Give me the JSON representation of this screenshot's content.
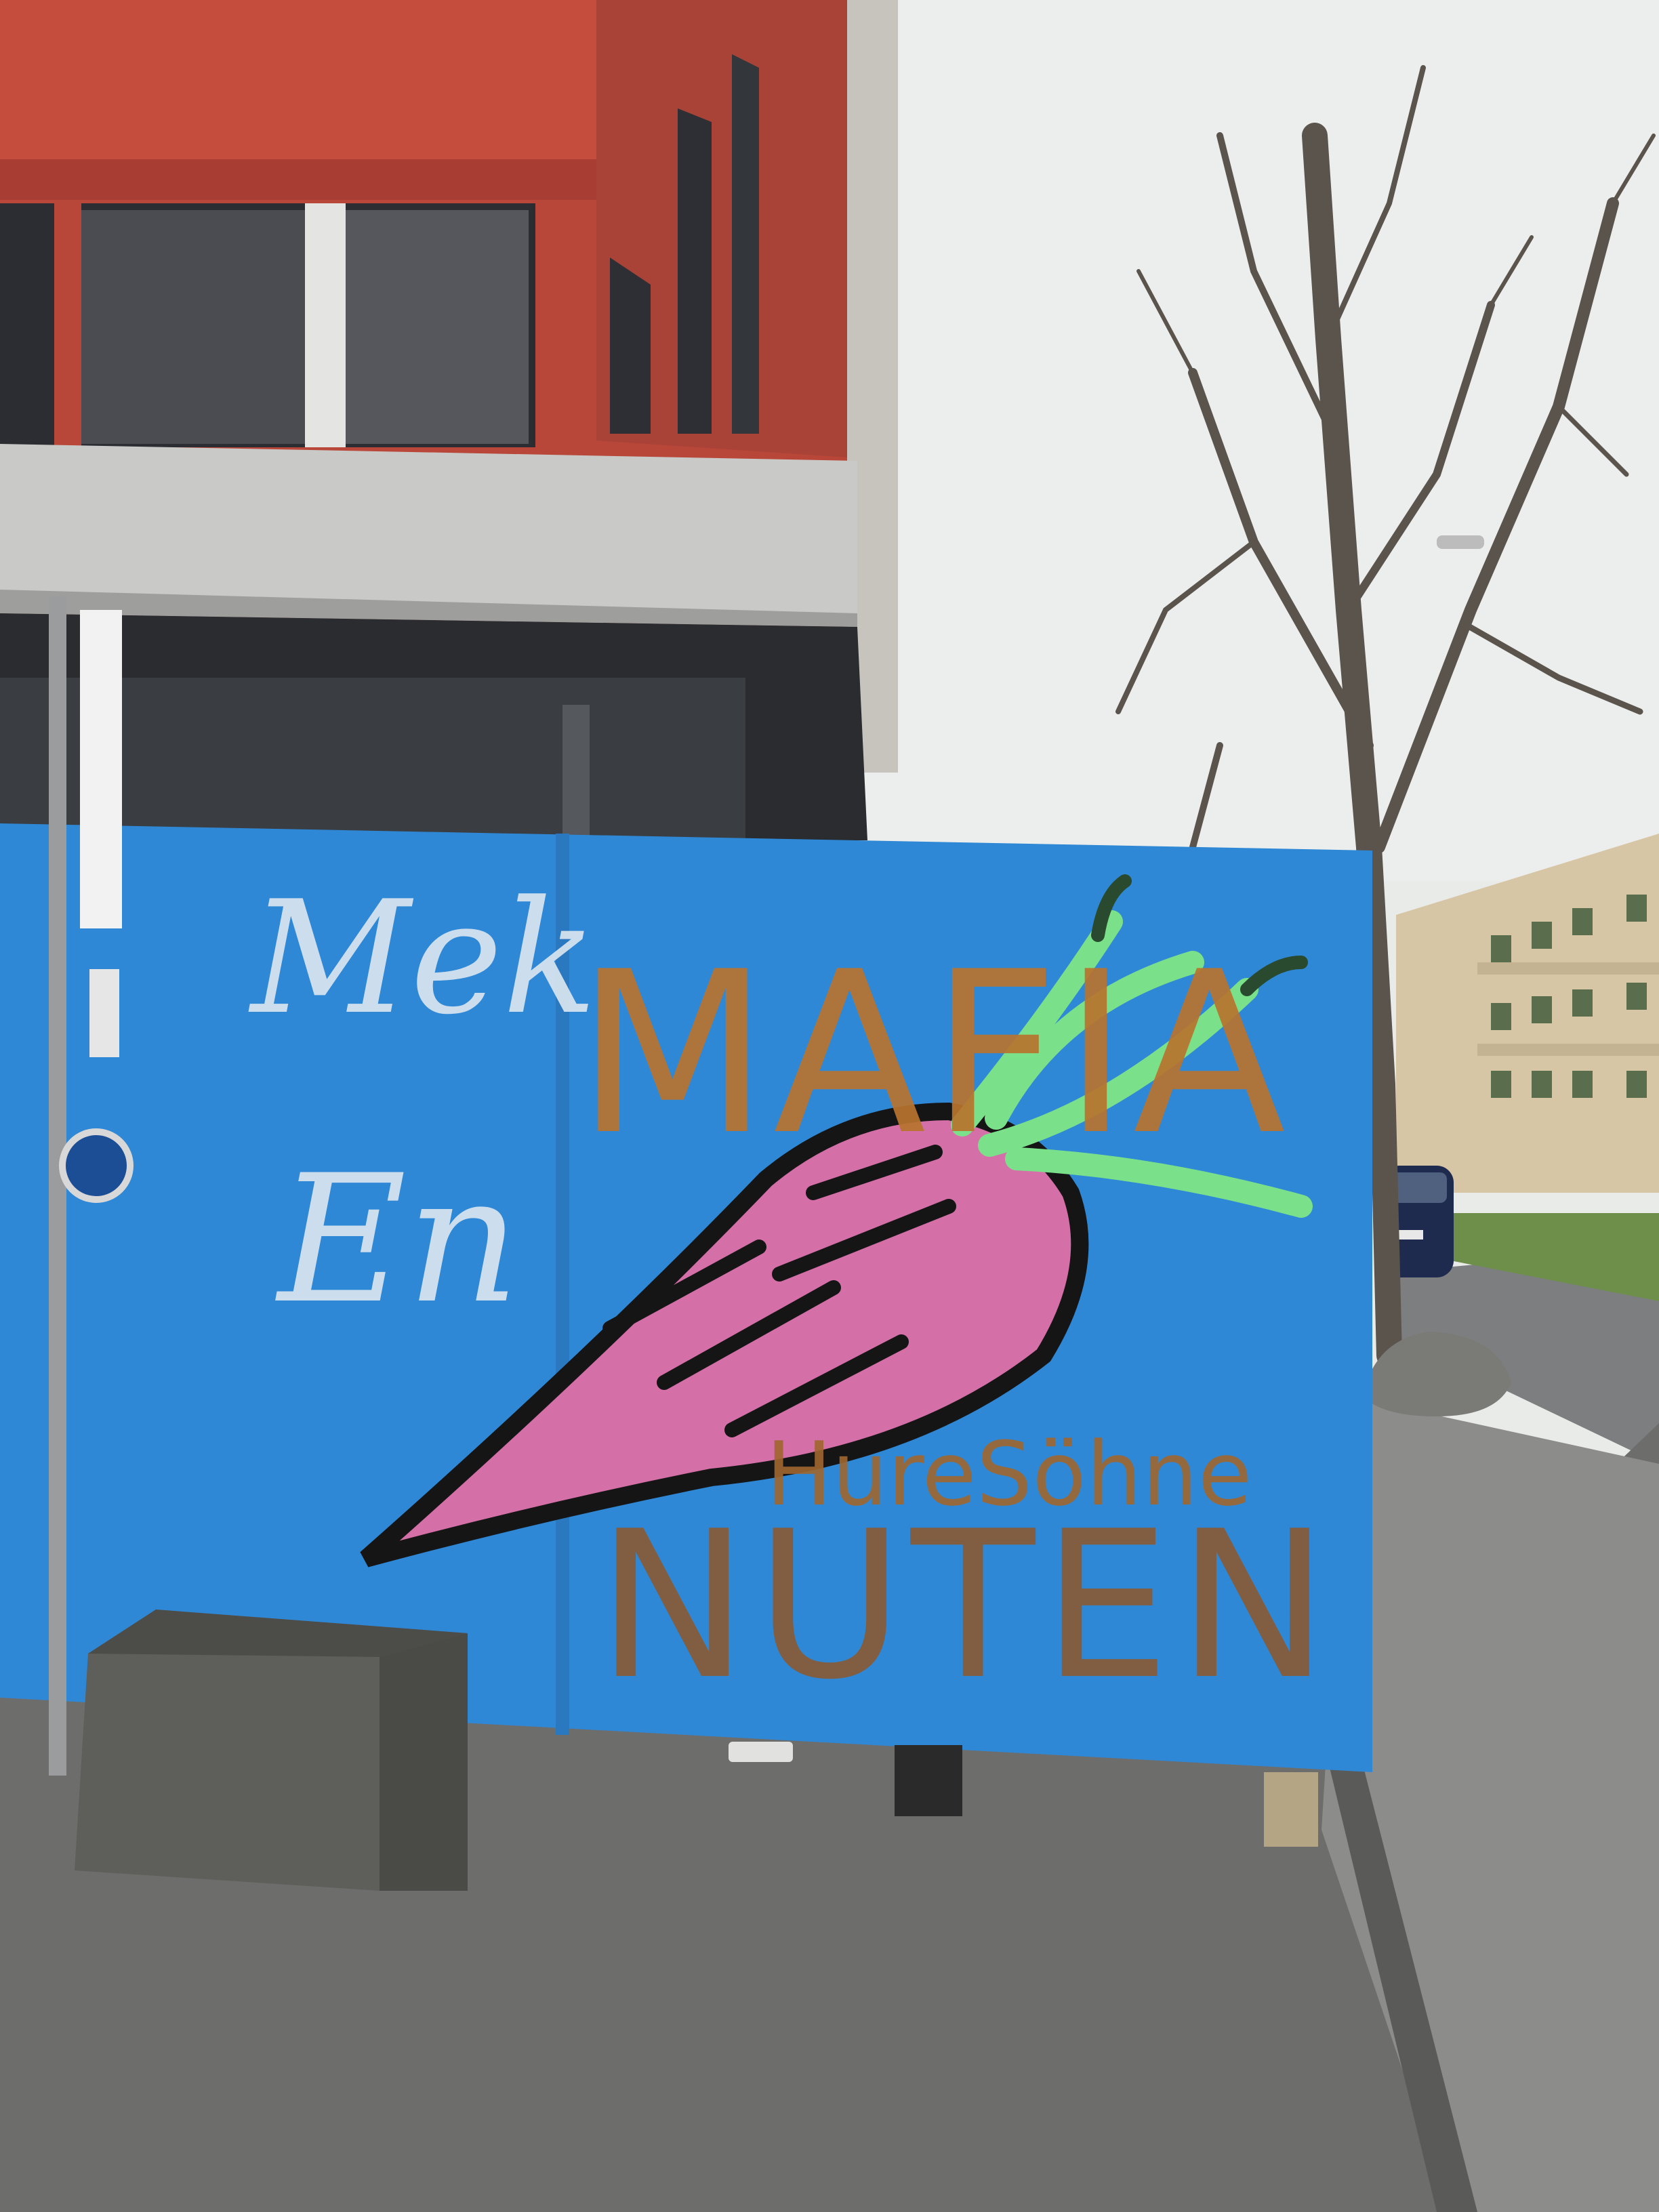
{
  "graffiti": {
    "tag_top_left": "Mek",
    "tag_mid_left": "En",
    "main_word": "MAFIA",
    "small_word": "HureSöhne",
    "bottom_word": "NUTEN"
  },
  "colors": {
    "wall_blue": "#2f88d6",
    "building_red": "#b8473a",
    "carrot_pink": "#d56fa8",
    "leaf_green": "#7be08a",
    "paint_brown": "#a0662e",
    "sky": "#eceeed",
    "pavement": "#6d6d6b"
  }
}
